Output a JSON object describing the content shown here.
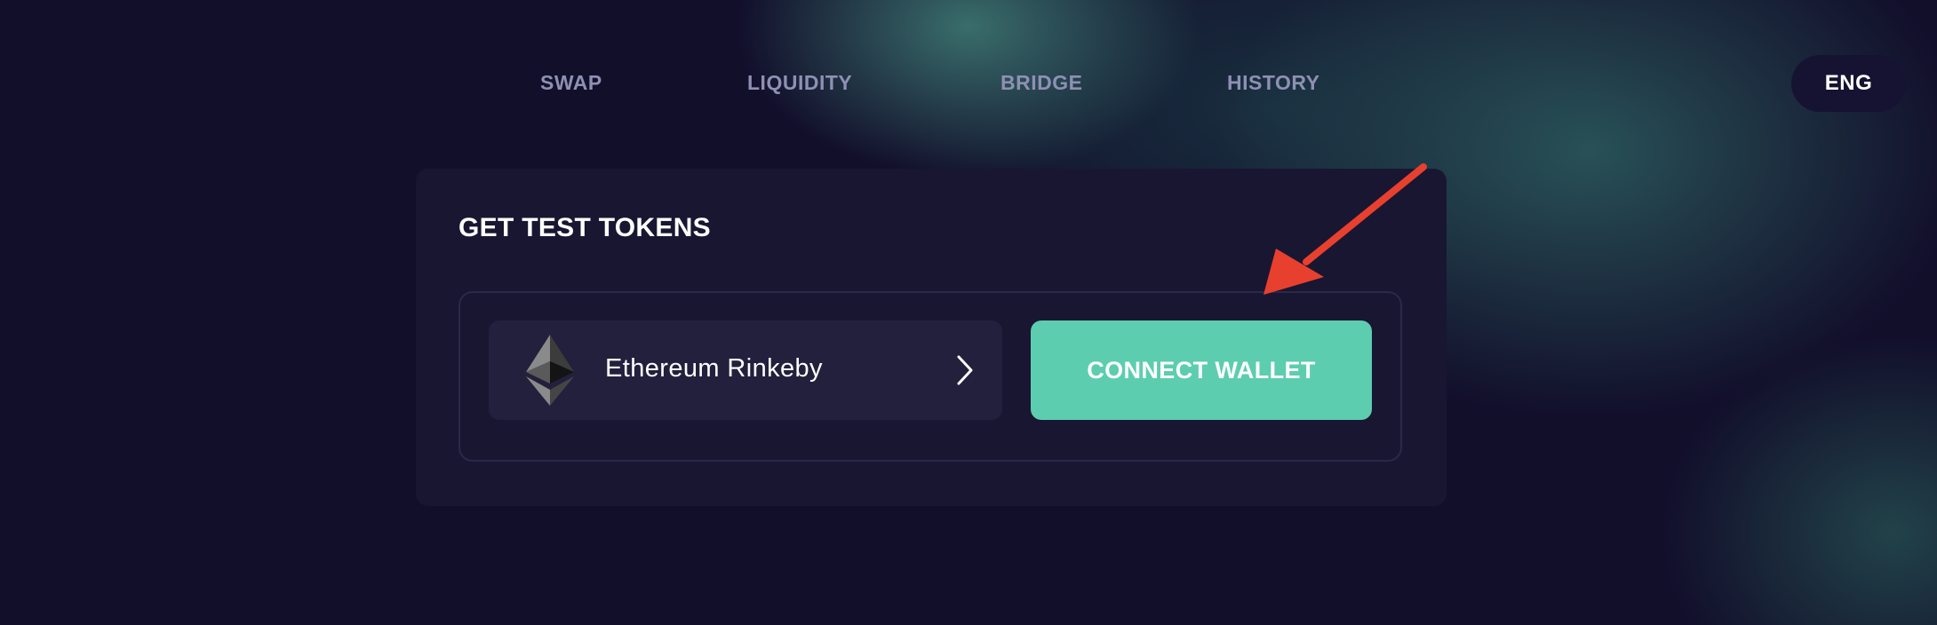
{
  "nav": {
    "items": [
      {
        "label": "SWAP"
      },
      {
        "label": "LIQUIDITY"
      },
      {
        "label": "BRIDGE"
      },
      {
        "label": "HISTORY"
      }
    ],
    "language": "ENG"
  },
  "card": {
    "title": "GET TEST TOKENS",
    "network": {
      "label": "Ethereum Rinkeby",
      "icon": "ethereum-icon"
    },
    "connect_button": "CONNECT WALLET"
  },
  "colors": {
    "background": "#120f2b",
    "card": "#191632",
    "accent": "#5dcdb0",
    "nav_text": "#8e90b3",
    "annotation_arrow": "#e8402e"
  }
}
